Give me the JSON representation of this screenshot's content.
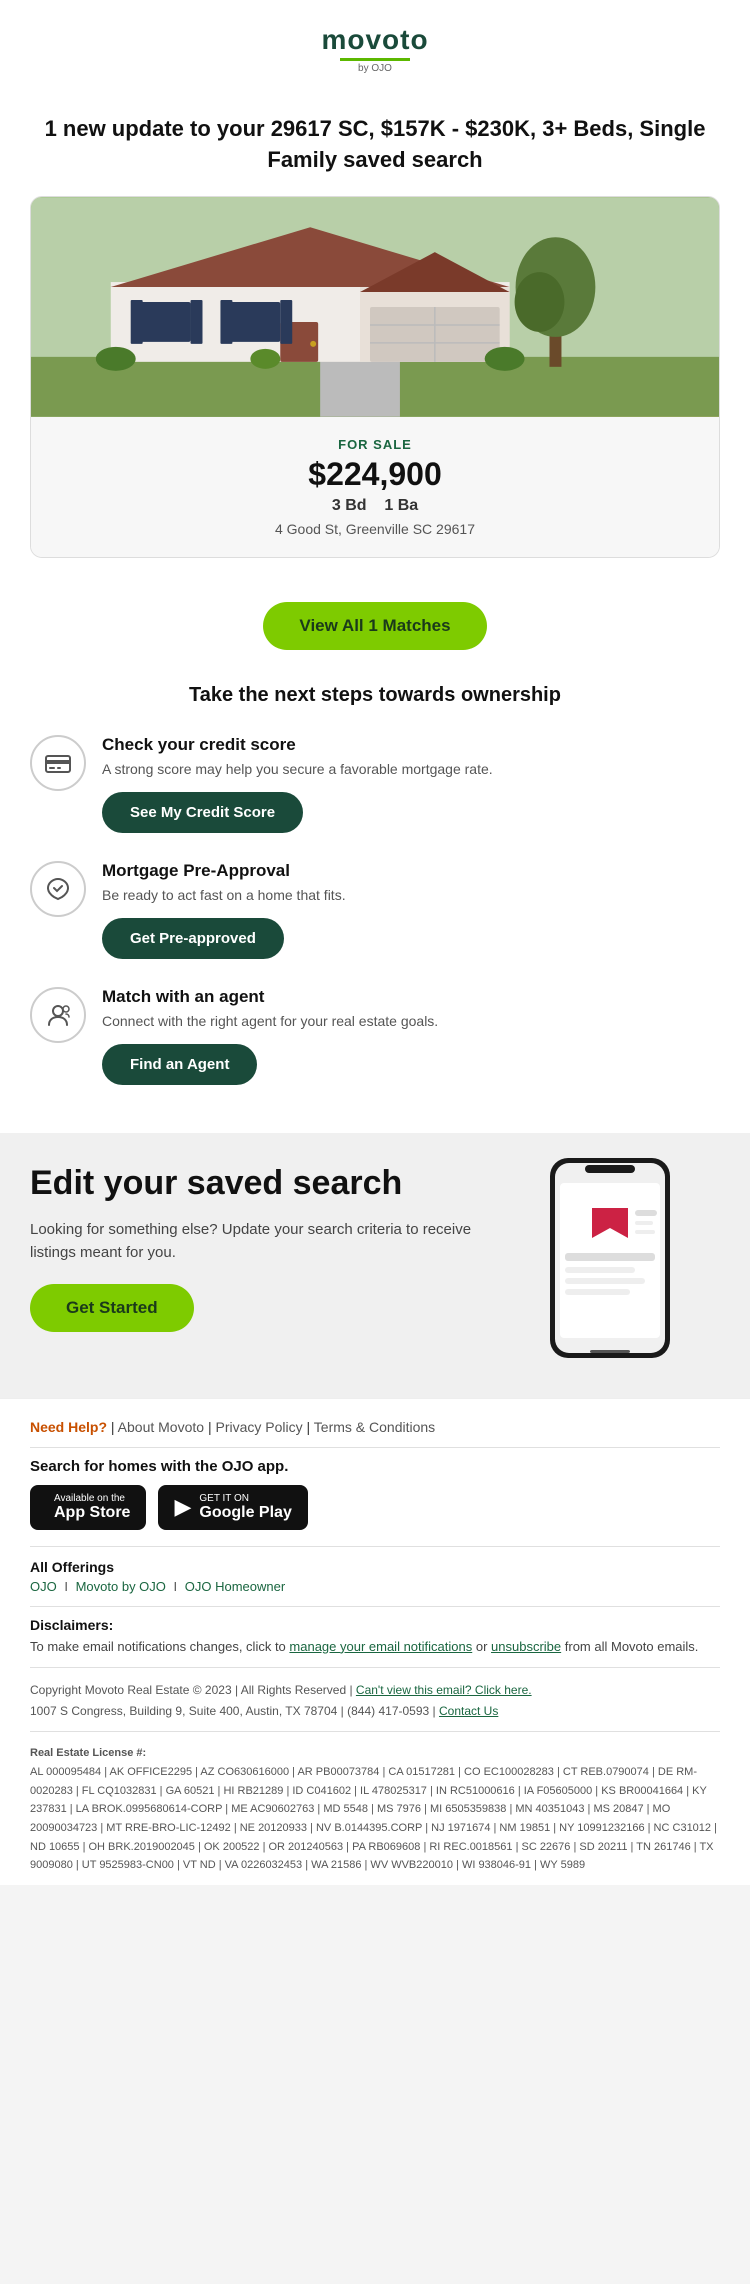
{
  "header": {
    "logo_text": "movoto",
    "logo_byline": "by OJO"
  },
  "notification": {
    "title": "1 new update to your 29617 SC, $157K - $230K, 3+ Beds, Single Family saved search"
  },
  "property": {
    "status": "FOR SALE",
    "price": "$224,900",
    "beds": "3",
    "beds_label": "Bd",
    "baths": "1",
    "baths_label": "Ba",
    "address": "4 Good St, Greenville SC 29617"
  },
  "cta": {
    "view_all_label": "View All 1 Matches"
  },
  "next_steps": {
    "title": "Take the next steps towards ownership",
    "steps": [
      {
        "id": "credit-score",
        "title": "Check your credit score",
        "description": "A strong score may help you secure a favorable mortgage rate.",
        "button_label": "See My Credit Score",
        "icon": "💳"
      },
      {
        "id": "pre-approval",
        "title": "Mortgage Pre-Approval",
        "description": "Be ready to act fast on a home that fits.",
        "button_label": "Get Pre-approved",
        "icon": "🤝"
      },
      {
        "id": "agent",
        "title": "Match with an agent",
        "description": "Connect with the right agent for your real estate goals.",
        "button_label": "Find an Agent",
        "icon": "👤"
      }
    ]
  },
  "edit_search": {
    "title": "Edit your saved search",
    "description": "Looking for something else? Update your search criteria to receive listings meant for you.",
    "button_label": "Get Started"
  },
  "footer": {
    "need_help_label": "Need Help?",
    "links": [
      {
        "label": "About Movoto"
      },
      {
        "label": "Privacy Policy"
      },
      {
        "label": "Terms & Conditions"
      }
    ],
    "app_section_title": "Search for homes with the OJO app.",
    "app_store_label": "Available on the",
    "app_store_name": "App Store",
    "google_play_label": "GET IT ON",
    "google_play_name": "Google Play",
    "all_offerings_title": "All Offerings",
    "offerings": [
      {
        "label": "OJO"
      },
      {
        "label": "Movoto by OJO"
      },
      {
        "label": "OJO Homeowner"
      }
    ],
    "disclaimers_title": "Disclaimers:",
    "disclaimers_text": "To make email notifications changes, click to ",
    "manage_notifications_label": "manage your email notifications",
    "or_label": " or ",
    "unsubscribe_label": "unsubscribe",
    "from_label": " from all Movoto emails.",
    "copyright": "Copyright Movoto Real Estate © 2023  |  All Rights Reserved  |  ",
    "cant_view_label": "Can't view this email? Click here.",
    "address": "1007 S Congress, Building 9, Suite 400, Austin, TX 78704",
    "phone": "(844) 417-0593",
    "contact": "Contact Us",
    "real_estate_title": "Real Estate License #:",
    "real_estate_text": "AL 000095484 | AK OFFICE2295 | AZ CO630616000 | AR PB00073784 | CA 01517281 | CO EC100028283 | CT REB.0790074 | DE RM-0020283 | FL CQ1032831 | GA 60521 | HI RB21289 | ID C041602 | IL 478025317 | IN RC51000616 | IA F05605000 | KS BR00041664 | KY 237831 | LA BROK.0995680614-CORP | ME AC90602763 | MD 5548 | MS 7976 | MI 6505359838 | MN 40351043 | MS 20847 | MO 20090034723 | MT RRE-BRO-LIC-12492 | NE 20120933 | NV B.0144395.CORP | NJ 1971674 | NM 19851 | NY 10991232166 | NC C31012 | ND 10655 | OH BRK.2019002045 | OK 200522 | OR 201240563 | PA RB069608 | RI REC.0018561 | SC 22676 | SD 20211 | TN 261746 | TX 9009080 | UT 9525983-CN00 | VT ND | VA 0226032453 | WA 21586 | WV WVB220010 | WI 938046-91 | WY 5989"
  }
}
